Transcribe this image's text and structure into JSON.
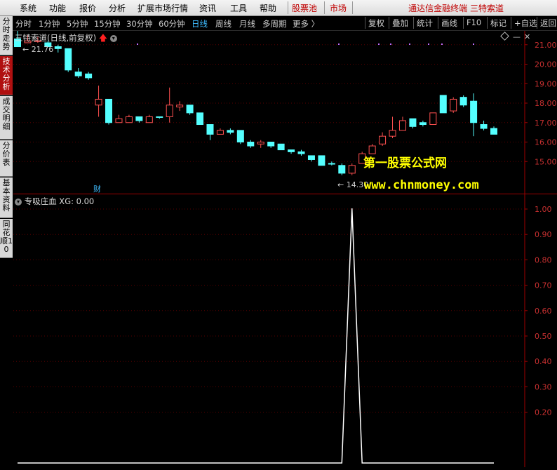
{
  "menu": {
    "items": [
      "系统",
      "功能",
      "报价",
      "分析",
      "扩展市场行情",
      "资讯",
      "工具",
      "帮助"
    ],
    "hot_items": [
      "股票池",
      "市场"
    ],
    "title": "通达信金融终端  三特索道"
  },
  "periods": {
    "items": [
      "分时",
      "1分钟",
      "5分钟",
      "15分钟",
      "30分钟",
      "60分钟",
      "日线",
      "周线",
      "月线",
      "多周期",
      "更多 〉"
    ],
    "active": "日线"
  },
  "tools": [
    "复权",
    "叠加",
    "统计",
    "画线",
    "F10",
    "标记",
    "+自选",
    "返回"
  ],
  "sidebar": {
    "tabs": [
      "分时走势",
      "技术分析",
      "成交明细",
      "分价表",
      "基本资料",
      "同花顺10"
    ],
    "active": "技术分析"
  },
  "main_chart": {
    "title": "三特索道(日线,前复权)",
    "high_label": "21.76",
    "low_label": "14.30",
    "cai_marker": "财",
    "y_ticks": [
      "21.00",
      "20.00",
      "19.00",
      "18.00",
      "17.00",
      "16.00",
      "15.00"
    ],
    "colors": {
      "up": "#ff5050",
      "down": "#54ffff",
      "grid": "#5a0000",
      "axis": "#a00000"
    }
  },
  "sub_chart": {
    "title": "专吸庄血  XG: 0.00",
    "y_ticks": [
      "1.00",
      "0.90",
      "0.80",
      "0.70",
      "0.60",
      "0.50",
      "0.40",
      "0.30",
      "0.20"
    ]
  },
  "watermark": {
    "line1": "第一股票公式网",
    "line2": "www.chnmoney.com"
  },
  "chart_data": {
    "type": "candlestick",
    "ylim": [
      14.0,
      22.0
    ],
    "candles": [
      {
        "o": 21.3,
        "h": 21.8,
        "l": 20.9,
        "c": 20.9,
        "d": 1
      },
      {
        "o": 21.1,
        "h": 21.5,
        "l": 21.1,
        "c": 21.2,
        "d": 0
      },
      {
        "o": 21.2,
        "h": 21.4,
        "l": 21.1,
        "c": 21.2,
        "d": 0
      },
      {
        "o": 21.1,
        "h": 21.2,
        "l": 20.9,
        "c": 20.9,
        "d": 1
      },
      {
        "o": 20.9,
        "h": 21.0,
        "l": 20.6,
        "c": 20.8,
        "d": 1
      },
      {
        "o": 20.8,
        "h": 20.8,
        "l": 19.6,
        "c": 19.7,
        "d": 1
      },
      {
        "o": 19.6,
        "h": 19.8,
        "l": 19.3,
        "c": 19.4,
        "d": 1
      },
      {
        "o": 19.5,
        "h": 19.6,
        "l": 19.2,
        "c": 19.3,
        "d": 1
      },
      {
        "o": 17.9,
        "h": 18.9,
        "l": 17.3,
        "c": 18.2,
        "d": 0
      },
      {
        "o": 18.2,
        "h": 18.2,
        "l": 16.9,
        "c": 17.0,
        "d": 1
      },
      {
        "o": 17.0,
        "h": 17.4,
        "l": 17.0,
        "c": 17.2,
        "d": 0
      },
      {
        "o": 17.0,
        "h": 17.4,
        "l": 17.0,
        "c": 17.3,
        "d": 0
      },
      {
        "o": 17.3,
        "h": 17.3,
        "l": 17.0,
        "c": 17.1,
        "d": 1
      },
      {
        "o": 17.0,
        "h": 17.4,
        "l": 17.0,
        "c": 17.3,
        "d": 0
      },
      {
        "o": 17.3,
        "h": 17.3,
        "l": 17.2,
        "c": 17.3,
        "d": 1
      },
      {
        "o": 17.3,
        "h": 18.8,
        "l": 17.0,
        "c": 17.9,
        "d": 0
      },
      {
        "o": 17.8,
        "h": 18.1,
        "l": 17.6,
        "c": 17.9,
        "d": 0
      },
      {
        "o": 17.9,
        "h": 17.9,
        "l": 17.4,
        "c": 17.5,
        "d": 1
      },
      {
        "o": 17.5,
        "h": 17.5,
        "l": 16.9,
        "c": 16.9,
        "d": 1
      },
      {
        "o": 16.9,
        "h": 16.9,
        "l": 16.1,
        "c": 16.4,
        "d": 1
      },
      {
        "o": 16.4,
        "h": 16.7,
        "l": 16.4,
        "c": 16.6,
        "d": 0
      },
      {
        "o": 16.6,
        "h": 16.7,
        "l": 16.4,
        "c": 16.5,
        "d": 1
      },
      {
        "o": 16.6,
        "h": 16.6,
        "l": 15.9,
        "c": 16.0,
        "d": 1
      },
      {
        "o": 16.0,
        "h": 16.1,
        "l": 15.7,
        "c": 15.8,
        "d": 1
      },
      {
        "o": 15.9,
        "h": 16.1,
        "l": 15.7,
        "c": 16.0,
        "d": 0
      },
      {
        "o": 16.0,
        "h": 16.0,
        "l": 15.7,
        "c": 15.8,
        "d": 1
      },
      {
        "o": 15.9,
        "h": 15.9,
        "l": 15.6,
        "c": 15.6,
        "d": 1
      },
      {
        "o": 15.6,
        "h": 15.6,
        "l": 15.4,
        "c": 15.5,
        "d": 1
      },
      {
        "o": 15.5,
        "h": 15.6,
        "l": 15.3,
        "c": 15.4,
        "d": 1
      },
      {
        "o": 15.3,
        "h": 15.3,
        "l": 15.0,
        "c": 15.1,
        "d": 1
      },
      {
        "o": 15.3,
        "h": 15.3,
        "l": 14.8,
        "c": 14.8,
        "d": 1
      },
      {
        "o": 14.9,
        "h": 15.0,
        "l": 14.8,
        "c": 14.9,
        "d": 1
      },
      {
        "o": 14.8,
        "h": 14.9,
        "l": 14.3,
        "c": 14.4,
        "d": 1
      },
      {
        "o": 14.4,
        "h": 14.9,
        "l": 14.3,
        "c": 14.8,
        "d": 0
      },
      {
        "o": 14.9,
        "h": 15.5,
        "l": 14.9,
        "c": 15.4,
        "d": 0
      },
      {
        "o": 15.4,
        "h": 15.9,
        "l": 15.4,
        "c": 15.8,
        "d": 0
      },
      {
        "o": 15.9,
        "h": 16.5,
        "l": 15.8,
        "c": 16.3,
        "d": 0
      },
      {
        "o": 16.3,
        "h": 17.3,
        "l": 16.2,
        "c": 16.6,
        "d": 0
      },
      {
        "o": 16.6,
        "h": 17.3,
        "l": 16.6,
        "c": 17.1,
        "d": 0
      },
      {
        "o": 17.2,
        "h": 17.2,
        "l": 16.7,
        "c": 16.8,
        "d": 1
      },
      {
        "o": 16.9,
        "h": 17.1,
        "l": 16.8,
        "c": 17.0,
        "d": 1
      },
      {
        "o": 16.9,
        "h": 17.5,
        "l": 16.9,
        "c": 17.5,
        "d": 0
      },
      {
        "o": 17.5,
        "h": 18.4,
        "l": 17.5,
        "c": 18.4,
        "d": 1
      },
      {
        "o": 17.6,
        "h": 18.3,
        "l": 17.5,
        "c": 18.2,
        "d": 0
      },
      {
        "o": 18.3,
        "h": 18.4,
        "l": 17.8,
        "c": 17.9,
        "d": 1
      },
      {
        "o": 18.1,
        "h": 18.5,
        "l": 16.3,
        "c": 17.0,
        "d": 1
      },
      {
        "o": 16.9,
        "h": 17.1,
        "l": 16.6,
        "c": 16.7,
        "d": 1
      },
      {
        "o": 16.7,
        "h": 16.8,
        "l": 16.4,
        "c": 16.4,
        "d": 1
      }
    ],
    "indicator": {
      "name": "专吸庄血",
      "ylim": [
        0.1,
        1.05
      ],
      "values": [
        0,
        0,
        0,
        0,
        0,
        0,
        0,
        0,
        0,
        0,
        0,
        0,
        0,
        0,
        0,
        0,
        0,
        0,
        0,
        0,
        0,
        0,
        0,
        0,
        0,
        0,
        0,
        0,
        0,
        0,
        0,
        0,
        0,
        1.0,
        0,
        0,
        0,
        0,
        0,
        0,
        0,
        0,
        0,
        0,
        0,
        0,
        0,
        0
      ]
    }
  }
}
